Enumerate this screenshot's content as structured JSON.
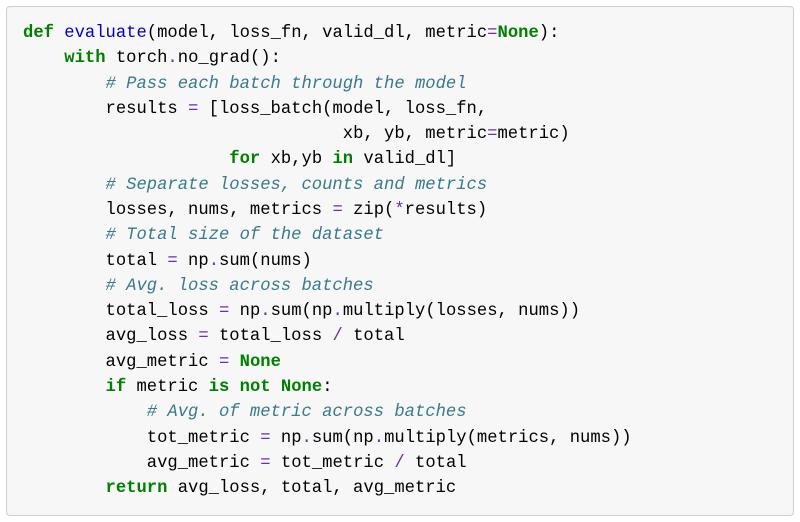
{
  "code": {
    "l1": {
      "def": "def",
      "fn": "evaluate",
      "sig1": "(model, loss_fn, valid_dl, metric",
      "eq": "=",
      "none": "None",
      "sig2": "):"
    },
    "l2": {
      "with": "with",
      "rest": " torch",
      "dot": ".",
      "ng": "no_grad():"
    },
    "l3": {
      "cm": "# Pass each batch through the model"
    },
    "l4": {
      "a": "results ",
      "eq": "=",
      "b": " [loss_batch(model, loss_fn,"
    },
    "l5": {
      "a": "xb, yb, metric",
      "eq": "=",
      "b": "metric)"
    },
    "l6": {
      "for": "for",
      "mid": " xb,yb ",
      "in": "in",
      "tail": " valid_dl]"
    },
    "l7": {
      "cm": "# Separate losses, counts and metrics"
    },
    "l8": {
      "a": "losses, nums, metrics ",
      "eq": "=",
      "b": " zip(",
      "star": "*",
      "c": "results)"
    },
    "l9": {
      "cm": "# Total size of the dataset"
    },
    "l10": {
      "a": "total ",
      "eq": "=",
      "b": " np",
      "dot": ".",
      "c": "sum(nums)"
    },
    "l11": {
      "cm": "# Avg. loss across batches"
    },
    "l12": {
      "a": "total_loss ",
      "eq": "=",
      "b": " np",
      "d1": ".",
      "c": "sum(np",
      "d2": ".",
      "d": "multiply(losses, nums))"
    },
    "l13": {
      "a": "avg_loss ",
      "eq": "=",
      "b": " total_loss ",
      "sl": "/",
      "c": " total"
    },
    "l14": {
      "a": "avg_metric ",
      "eq": "=",
      "sp": " ",
      "none": "None"
    },
    "l15": {
      "if": "if",
      "a": " metric ",
      "is": "is",
      "sp": " ",
      "not": "not",
      "sp2": " ",
      "none": "None",
      "colon": ":"
    },
    "l16": {
      "cm": "# Avg. of metric across batches"
    },
    "l17": {
      "a": "tot_metric ",
      "eq": "=",
      "b": " np",
      "d1": ".",
      "c": "sum(np",
      "d2": ".",
      "d": "multiply(metrics, nums))"
    },
    "l18": {
      "a": "avg_metric ",
      "eq": "=",
      "b": " tot_metric ",
      "sl": "/",
      "c": " total"
    },
    "l19": {
      "ret": "return",
      "rest": " avg_loss, total, avg_metric"
    }
  },
  "indent": {
    "i1": "    ",
    "i2": "        ",
    "i3": "            ",
    "l5pad": "                               ",
    "l6pad": "                    "
  }
}
